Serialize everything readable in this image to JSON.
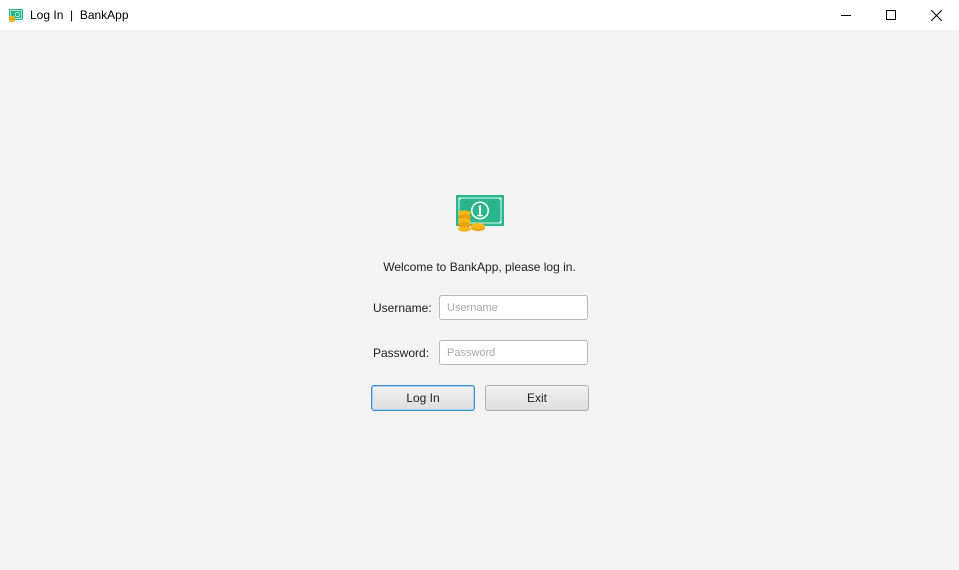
{
  "window": {
    "title": "Log In  |  BankApp",
    "icon": "bankapp-money-icon",
    "controls": {
      "minimize": "minimize-icon",
      "maximize": "maximize-icon",
      "close": "close-icon"
    }
  },
  "login": {
    "logo": "cash-and-coins-icon",
    "welcome": "Welcome to BankApp, please log in.",
    "username_label": "Username:",
    "username_placeholder": "Username",
    "username_value": "",
    "password_label": "Password:",
    "password_placeholder": "Password",
    "password_value": "",
    "login_button": "Log In",
    "exit_button": "Exit"
  },
  "colors": {
    "background": "#f3f3f3",
    "titlebar": "#ffffff",
    "banknote": "#2bb58c",
    "coin": "#f5b818",
    "focus_border": "#3c8ec9"
  }
}
